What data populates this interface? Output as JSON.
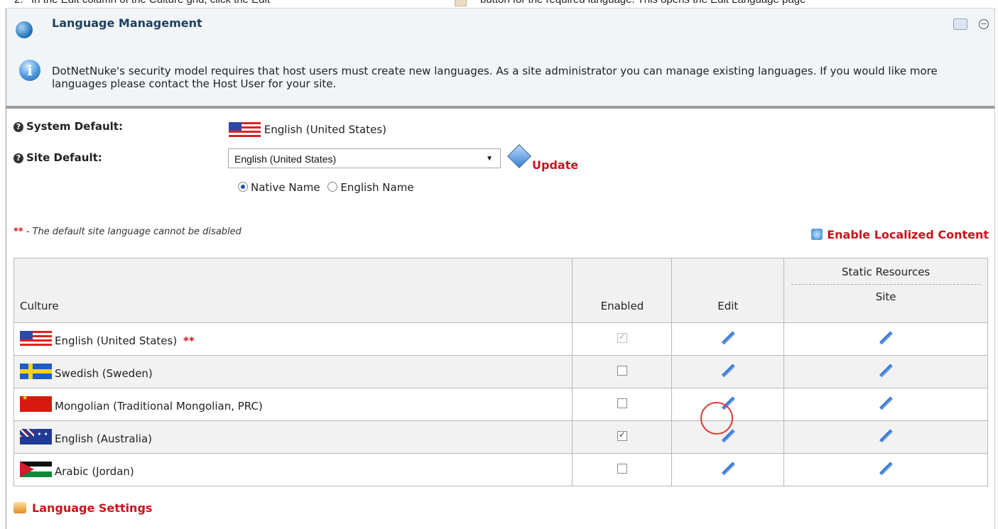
{
  "instruction": {
    "number": "2.",
    "before": "In the Edit column of the Culture grid, click the Edit",
    "after": "button for the required language. This opens the Edit Language page"
  },
  "module": {
    "title": "Language Management",
    "info_text": "DotNetNuke's security model requires that host users must create new languages. As a site administrator you can manage existing languages. If you would like more languages please contact the Host User for your site."
  },
  "settings": {
    "system_default_label": "System Default:",
    "system_default_value": "English (United States)",
    "site_default_label": "Site Default:",
    "site_default_selected": "English (United States)",
    "update_label": "Update",
    "radio_native": "Native Name",
    "radio_english": "English Name",
    "native_selected": true
  },
  "note": {
    "stars": "**",
    "text": " - The default site language cannot be disabled"
  },
  "enable_localized_label": "Enable Localized Content",
  "grid": {
    "headers": {
      "culture": "Culture",
      "enabled": "Enabled",
      "edit": "Edit",
      "static_resources": "Static Resources",
      "site": "Site"
    },
    "rows": [
      {
        "flag": "flag-us",
        "name": "English (United States)",
        "marker": "**",
        "enabled": true,
        "disabled_checkbox": true
      },
      {
        "flag": "flag-se",
        "name": "Swedish (Sweden)",
        "marker": "",
        "enabled": false,
        "disabled_checkbox": false
      },
      {
        "flag": "flag-cn",
        "name": "Mongolian (Traditional Mongolian, PRC)",
        "marker": "",
        "enabled": false,
        "disabled_checkbox": false
      },
      {
        "flag": "flag-au",
        "name": "English (Australia)",
        "marker": "",
        "enabled": true,
        "disabled_checkbox": false
      },
      {
        "flag": "flag-jo",
        "name": "Arabic (Jordan)",
        "marker": "",
        "enabled": false,
        "disabled_checkbox": false
      }
    ]
  },
  "language_settings_label": "Language Settings",
  "colors": {
    "link_red": "#c8141c",
    "highlight_circle": "#e03a3a",
    "header_bg": "#f1f5f8"
  }
}
